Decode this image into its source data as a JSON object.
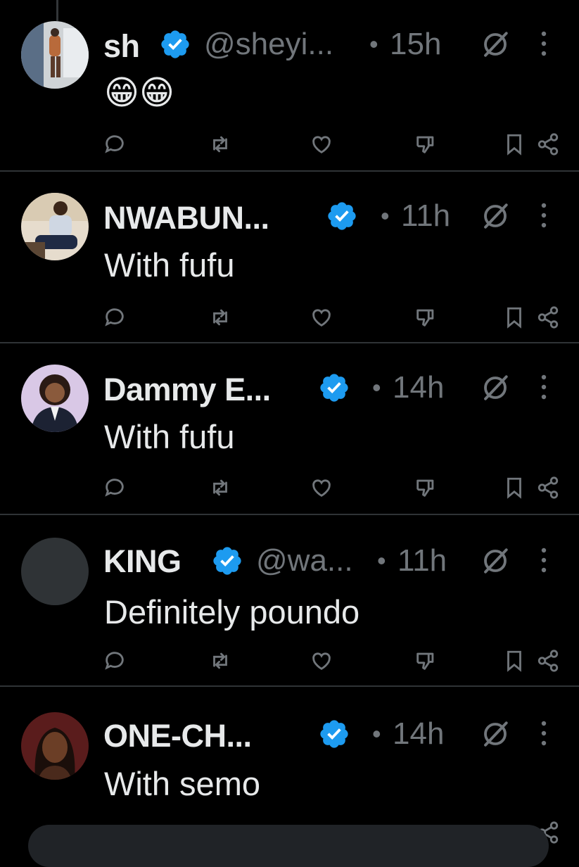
{
  "posts": [
    {
      "name": "sh",
      "handle": "@sheyi...",
      "separator": "•",
      "time": "15h",
      "text": "",
      "emoji": "😁😁"
    },
    {
      "name": "NWABUN...",
      "handle": "",
      "separator": "•",
      "time": "11h",
      "text": "With fufu"
    },
    {
      "name": "Dammy E...",
      "handle": "",
      "separator": "•",
      "time": "14h",
      "text": "With fufu"
    },
    {
      "name": "KING",
      "handle": "@wa...",
      "separator": "•",
      "time": "11h",
      "text": "Definitely poundo"
    },
    {
      "name": "ONE-CH...",
      "handle": "",
      "separator": "•",
      "time": "14h",
      "text": "With semo"
    }
  ],
  "icons": {
    "verified": "verified-badge-icon",
    "grok": "grok-icon",
    "more": "more-vertical-icon",
    "reply": "reply-icon",
    "repost": "repost-icon",
    "like": "like-icon",
    "dislike": "dislike-icon",
    "bookmark": "bookmark-icon",
    "share": "share-icon"
  },
  "colors": {
    "background": "#000000",
    "verified": "#1d9bf0",
    "muted": "#71767b",
    "text": "#e7e9ea",
    "divider": "#2f3336"
  }
}
